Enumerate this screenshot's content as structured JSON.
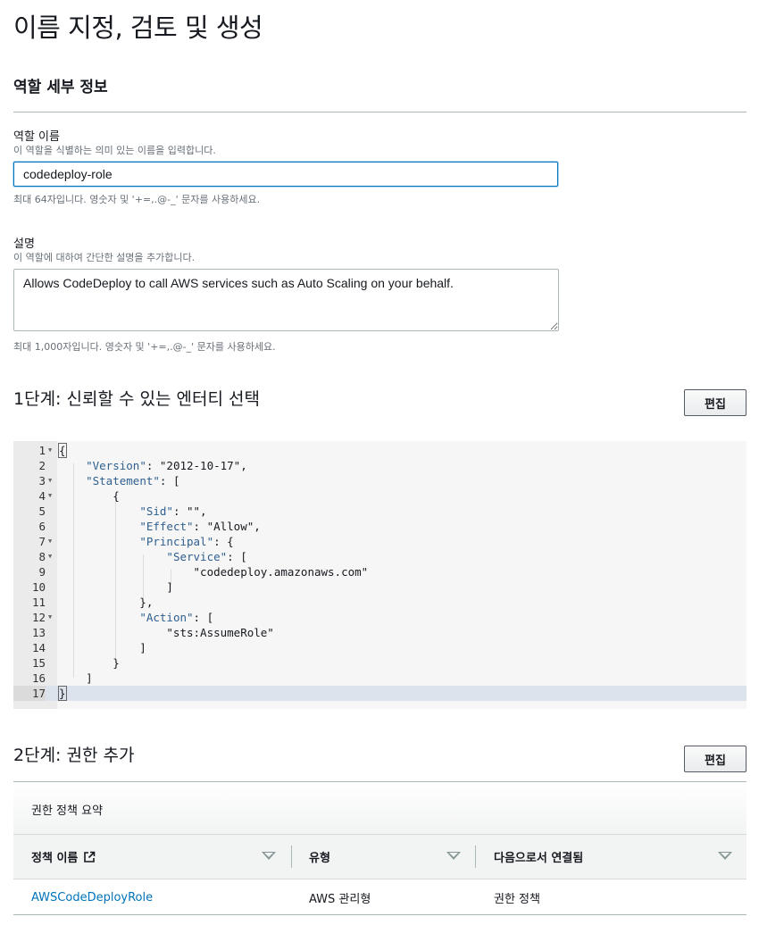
{
  "page": {
    "title": "이름 지정, 검토 및 생성"
  },
  "role_details": {
    "section_title": "역할 세부 정보",
    "name_label": "역할 이름",
    "name_description": "이 역할을 식별하는 의미 있는 이름을 입력합니다.",
    "name_value": "codedeploy-role",
    "name_hint": "최대 64자입니다. 영숫자 및 '+=,.@-_' 문자를 사용하세요.",
    "desc_label": "설명",
    "desc_description": "이 역할에 대하여 간단한 설명을 추가합니다.",
    "desc_value": "Allows CodeDeploy to call AWS services such as Auto Scaling on your behalf.",
    "desc_hint": "최대 1,000자입니다. 영숫자 및 '+=,.@-_' 문자를 사용하세요."
  },
  "step1": {
    "title": "1단계: 신뢰할 수 있는 엔터티 선택",
    "edit_label": "편집",
    "code_lines": [
      {
        "num": "1",
        "fold": true,
        "text": "{"
      },
      {
        "num": "2",
        "fold": false,
        "text": "    \"Version\": \"2012-10-17\","
      },
      {
        "num": "3",
        "fold": true,
        "text": "    \"Statement\": ["
      },
      {
        "num": "4",
        "fold": true,
        "text": "        {"
      },
      {
        "num": "5",
        "fold": false,
        "text": "            \"Sid\": \"\","
      },
      {
        "num": "6",
        "fold": false,
        "text": "            \"Effect\": \"Allow\","
      },
      {
        "num": "7",
        "fold": true,
        "text": "            \"Principal\": {"
      },
      {
        "num": "8",
        "fold": true,
        "text": "                \"Service\": ["
      },
      {
        "num": "9",
        "fold": false,
        "text": "                    \"codedeploy.amazonaws.com\""
      },
      {
        "num": "10",
        "fold": false,
        "text": "                ]"
      },
      {
        "num": "11",
        "fold": false,
        "text": "            },"
      },
      {
        "num": "12",
        "fold": true,
        "text": "            \"Action\": ["
      },
      {
        "num": "13",
        "fold": false,
        "text": "                \"sts:AssumeRole\""
      },
      {
        "num": "14",
        "fold": false,
        "text": "            ]"
      },
      {
        "num": "15",
        "fold": false,
        "text": "        }"
      },
      {
        "num": "16",
        "fold": false,
        "text": "    ]"
      },
      {
        "num": "17",
        "fold": false,
        "text": "}"
      }
    ]
  },
  "step2": {
    "title": "2단계: 권한 추가",
    "edit_label": "편집",
    "table_title": "권한 정책 요약",
    "columns": [
      "정책 이름",
      "유형",
      "다음으로서 연결됨"
    ],
    "rows": [
      {
        "policy_name": "AWSCodeDeployRole",
        "type": "AWS 관리형",
        "attached_as": "권한 정책"
      }
    ]
  },
  "icons": {
    "fold": "caret-down-icon",
    "external_link": "external-link-icon",
    "sort": "sort-down-icon"
  },
  "colors": {
    "accent": "#0073bb",
    "text": "#16191f",
    "muted": "#687078",
    "border": "#aab7b8"
  }
}
